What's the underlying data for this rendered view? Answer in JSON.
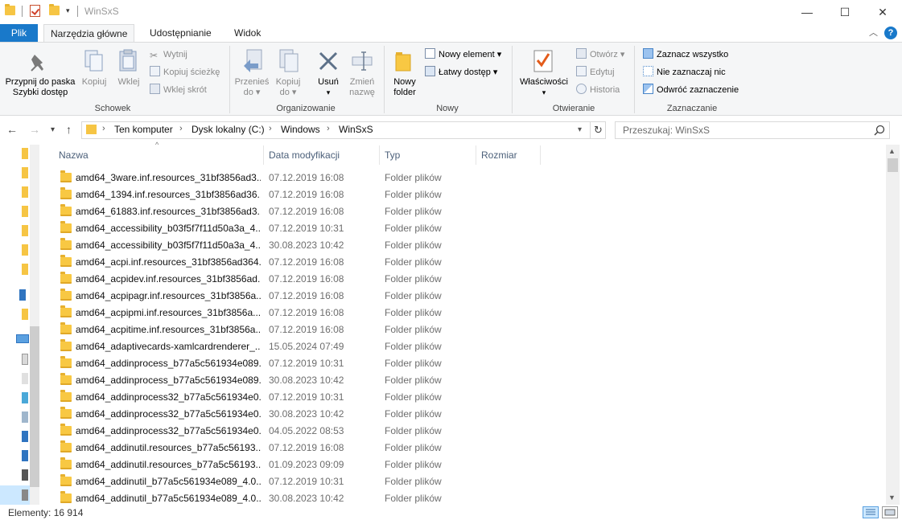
{
  "window": {
    "title": "WinSxS",
    "minimize": "—",
    "maximize": "☐",
    "close": "✕"
  },
  "tabs": [
    "Plik",
    "Narzędzia główne",
    "Udostępnianie",
    "Widok"
  ],
  "ribbon": {
    "clipboard": {
      "label": "Schowek",
      "pin": "Przypnij do paska\nSzybki dostęp",
      "pin_line1": "Przypnij do paska",
      "pin_line2": "Szybki dostęp",
      "copy": "Kopiuj",
      "paste": "Wklej",
      "cut": "Wytnij",
      "copy_path": "Kopiuj ścieżkę",
      "paste_shortcut": "Wklej skrót"
    },
    "organize": {
      "label": "Organizowanie",
      "move_to_1": "Przenieś",
      "move_to_2": "do",
      "copy_to_1": "Kopiuj",
      "copy_to_2": "do",
      "delete": "Usuń",
      "rename_1": "Zmień",
      "rename_2": "nazwę"
    },
    "new": {
      "label": "Nowy",
      "new_folder_1": "Nowy",
      "new_folder_2": "folder",
      "new_item": "Nowy element",
      "easy_access": "Łatwy dostęp"
    },
    "open": {
      "label": "Otwieranie",
      "properties": "Właściwości",
      "open": "Otwórz",
      "edit": "Edytuj",
      "history": "Historia"
    },
    "select": {
      "label": "Zaznaczanie",
      "select_all": "Zaznacz wszystko",
      "select_none": "Nie zaznaczaj nic",
      "invert": "Odwróć zaznaczenie"
    }
  },
  "address": {
    "crumbs": [
      "Ten komputer",
      "Dysk lokalny (C:)",
      "Windows",
      "WinSxS"
    ],
    "search_placeholder": "Przeszukaj: WinSxS"
  },
  "columns": [
    "Nazwa",
    "Data modyfikacji",
    "Typ",
    "Rozmiar"
  ],
  "files": [
    {
      "name": "amd64_3ware.inf.resources_31bf3856ad3...",
      "date": "07.12.2019 16:08",
      "type": "Folder plików"
    },
    {
      "name": "amd64_1394.inf.resources_31bf3856ad36...",
      "date": "07.12.2019 16:08",
      "type": "Folder plików"
    },
    {
      "name": "amd64_61883.inf.resources_31bf3856ad3...",
      "date": "07.12.2019 16:08",
      "type": "Folder plików"
    },
    {
      "name": "amd64_accessibility_b03f5f7f11d50a3a_4....",
      "date": "07.12.2019 10:31",
      "type": "Folder plików"
    },
    {
      "name": "amd64_accessibility_b03f5f7f11d50a3a_4....",
      "date": "30.08.2023 10:42",
      "type": "Folder plików"
    },
    {
      "name": "amd64_acpi.inf.resources_31bf3856ad364...",
      "date": "07.12.2019 16:08",
      "type": "Folder plików"
    },
    {
      "name": "amd64_acpidev.inf.resources_31bf3856ad...",
      "date": "07.12.2019 16:08",
      "type": "Folder plików"
    },
    {
      "name": "amd64_acpipagr.inf.resources_31bf3856a...",
      "date": "07.12.2019 16:08",
      "type": "Folder plików"
    },
    {
      "name": "amd64_acpipmi.inf.resources_31bf3856a...",
      "date": "07.12.2019 16:08",
      "type": "Folder plików"
    },
    {
      "name": "amd64_acpitime.inf.resources_31bf3856a...",
      "date": "07.12.2019 16:08",
      "type": "Folder plików"
    },
    {
      "name": "amd64_adaptivecards-xamlcardrenderer_...",
      "date": "15.05.2024 07:49",
      "type": "Folder plików"
    },
    {
      "name": "amd64_addinprocess_b77a5c561934e089...",
      "date": "07.12.2019 10:31",
      "type": "Folder plików"
    },
    {
      "name": "amd64_addinprocess_b77a5c561934e089...",
      "date": "30.08.2023 10:42",
      "type": "Folder plików"
    },
    {
      "name": "amd64_addinprocess32_b77a5c561934e0...",
      "date": "07.12.2019 10:31",
      "type": "Folder plików"
    },
    {
      "name": "amd64_addinprocess32_b77a5c561934e0...",
      "date": "30.08.2023 10:42",
      "type": "Folder plików"
    },
    {
      "name": "amd64_addinprocess32_b77a5c561934e0...",
      "date": "04.05.2022 08:53",
      "type": "Folder plików"
    },
    {
      "name": "amd64_addinutil.resources_b77a5c56193...",
      "date": "07.12.2019 16:08",
      "type": "Folder plików"
    },
    {
      "name": "amd64_addinutil.resources_b77a5c56193...",
      "date": "01.09.2023 09:09",
      "type": "Folder plików"
    },
    {
      "name": "amd64_addinutil_b77a5c561934e089_4.0....",
      "date": "07.12.2019 10:31",
      "type": "Folder plików"
    },
    {
      "name": "amd64_addinutil_b77a5c561934e089_4.0....",
      "date": "30.08.2023 10:42",
      "type": "Folder plików"
    }
  ],
  "status": {
    "count": "Elementy: 16 914"
  },
  "colors": {
    "accent": "#1979ca",
    "folder": "#f8c843",
    "ribbon_bg": "#f5f6f7",
    "header_text": "#4c607a"
  }
}
